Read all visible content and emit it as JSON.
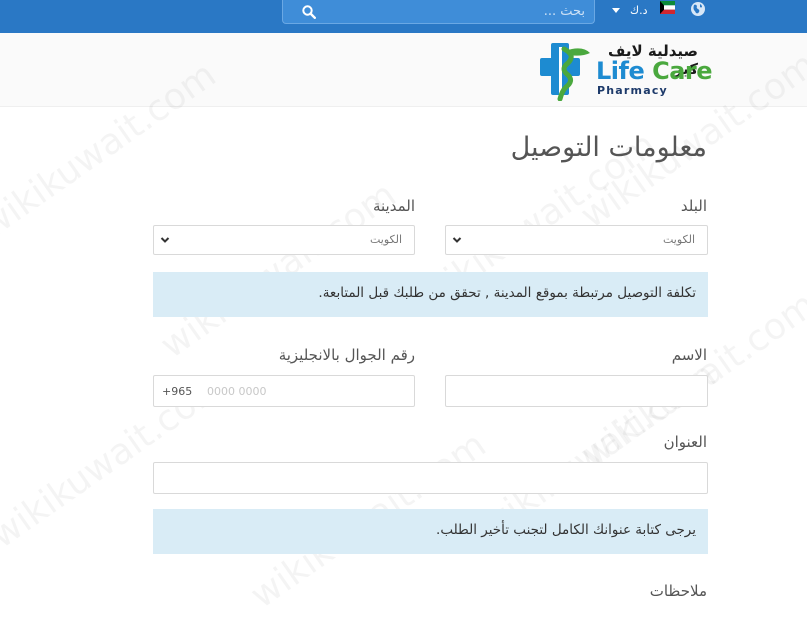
{
  "topbar": {
    "search_placeholder": "بحث ...",
    "currency": "د.ك",
    "colors": {
      "bar": "#2a78c5",
      "search": "#3f8dd8"
    }
  },
  "logo": {
    "arabic": "صيدلية لايف كير",
    "en_part1": "Life",
    "en_part2": "Care",
    "sub": "Pharmacy"
  },
  "form": {
    "title": "معلومات التوصيل",
    "country_label": "البلد",
    "country_value": "الكويت",
    "city_label": "المدينة",
    "city_value": "الكويت",
    "delivery_note": "تكلفة التوصيل مرتبطة بموقع المدينة , تحقق من طلبك قبل المتابعة.",
    "name_label": "الاسم",
    "phone_label": "رقم الجوال بالانجليزية",
    "phone_prefix": "+965",
    "phone_placeholder": "0000 0000",
    "address_label": "العنوان",
    "address_note": "يرجى كتابة عنوانك الكامل لتجنب تأخير الطلب.",
    "notes_label": "ملاحظات"
  },
  "watermark": "wikikuwait.com"
}
